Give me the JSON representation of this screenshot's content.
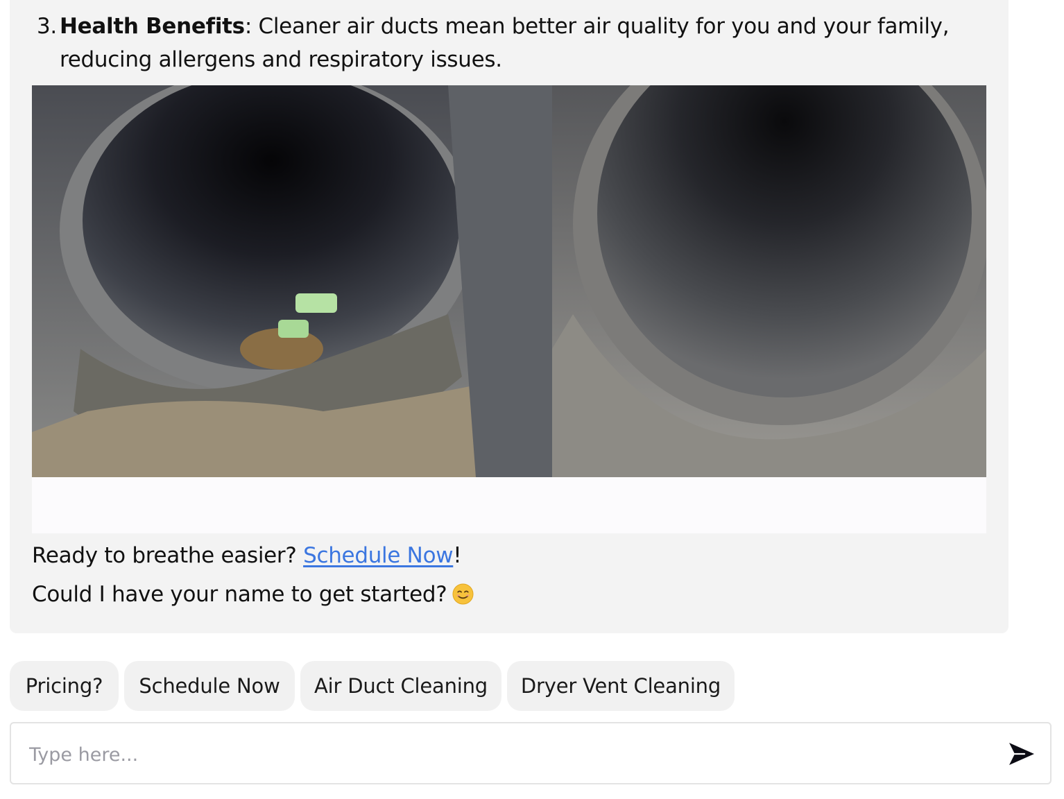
{
  "message": {
    "list_item": {
      "number": "3.",
      "bold_label": "Health Benefits",
      "text": ": Cleaner air ducts mean better air quality for you and your family, reducing allergens and respiratory issues."
    },
    "image": {
      "description_name": "before-after-duct-photo"
    },
    "cta_prefix": "Ready to breathe easier? ",
    "cta_link": "Schedule Now",
    "cta_suffix": "!",
    "name_prompt": "Could I have your name to get started?",
    "emoji": "smiling-face-emoji"
  },
  "quick_replies": [
    {
      "label": "Pricing?"
    },
    {
      "label": "Schedule Now"
    },
    {
      "label": "Air Duct Cleaning"
    },
    {
      "label": "Dryer Vent Cleaning"
    }
  ],
  "composer": {
    "placeholder": "Type here...",
    "send_icon": "send-icon"
  },
  "colors": {
    "bubble_bg": "#f3f3f3",
    "link": "#3b76e0",
    "chip_bg": "#f1f1f1",
    "input_border": "#e3e3e3"
  }
}
